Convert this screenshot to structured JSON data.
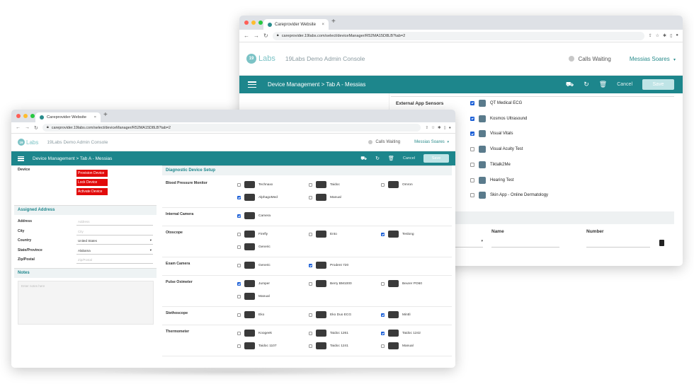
{
  "browser": {
    "tab_title": "Careprovider Website",
    "tab_close": "×",
    "new_tab": "+",
    "url_back": "←",
    "url_forward": "→",
    "url_reload": "↻",
    "back_url": "careprovider.19labs.com/select/deviceManager/R52MA15D8LB?tab=2",
    "front_url": "careprovider.19labs.com/select/deviceManager/R52MA15D8LB?tab=2"
  },
  "app": {
    "logo_badge": "19",
    "logo_text": "Labs",
    "console_title": "19Labs Demo Admin Console",
    "calls_waiting": "Calls Waiting",
    "user_name": "Messias Soares",
    "user_caret": "▾",
    "breadcrumb": "Device Management > Tab A - Messias",
    "cancel_label": "Cancel",
    "save_label": "Save"
  },
  "back_window": {
    "external_sensors_label": "External App Sensors",
    "external_sensors": [
      {
        "name": "QT Medical ECG",
        "checked": true
      },
      {
        "name": "Kosmos Ultrasound",
        "checked": true
      },
      {
        "name": "Visual Vitals",
        "checked": true
      },
      {
        "name": "Visual Acuity Test",
        "checked": false
      },
      {
        "name": "Tiktalk2Me",
        "checked": false
      },
      {
        "name": "Hearing Test",
        "checked": false
      },
      {
        "name": "Skin App - Online Dermatology",
        "checked": false
      }
    ],
    "name_col": "Name",
    "number_col": "Number"
  },
  "front_window": {
    "device_label": "Device",
    "device_buttons": [
      "Provision Device",
      "Lock Device",
      "Activate Device"
    ],
    "assigned_address_title": "Assigned Address",
    "address_fields": [
      {
        "label": "Address",
        "value": "Address"
      },
      {
        "label": "City",
        "value": "City"
      },
      {
        "label": "Country",
        "value": "United States"
      },
      {
        "label": "State/Province",
        "value": "Alabama"
      },
      {
        "label": "Zip/Postal",
        "value": "Zip/Postal"
      }
    ],
    "notes_title": "Notes",
    "notes_placeholder": "Enter notes here",
    "diag_title": "Diagnostic Device Setup",
    "categories": [
      {
        "label": "Blood Pressure Monitor",
        "devices": [
          {
            "name": "Technaxx",
            "checked": false
          },
          {
            "name": "Taidoc",
            "checked": false
          },
          {
            "name": "Omron",
            "checked": false
          },
          {
            "name": "AlphagoMed",
            "checked": true
          },
          {
            "name": "Manual",
            "checked": false
          }
        ]
      },
      {
        "label": "Internal Camera",
        "devices": [
          {
            "name": "Camera",
            "checked": true
          }
        ]
      },
      {
        "label": "Otoscope",
        "devices": [
          {
            "name": "Firefly",
            "checked": false
          },
          {
            "name": "Ento",
            "checked": false
          },
          {
            "name": "Teslong",
            "checked": true
          },
          {
            "name": "Generic",
            "checked": false
          }
        ]
      },
      {
        "label": "Exam Camera",
        "devices": [
          {
            "name": "Generic",
            "checked": false
          },
          {
            "name": "Prodent 720",
            "checked": true
          }
        ]
      },
      {
        "label": "Pulse Oximeter",
        "devices": [
          {
            "name": "Jumper",
            "checked": true
          },
          {
            "name": "Berry BM1000",
            "checked": false
          },
          {
            "name": "Beurer PO60",
            "checked": false
          },
          {
            "name": "Manual",
            "checked": false
          }
        ]
      },
      {
        "label": "Stethoscope",
        "devices": [
          {
            "name": "Eko",
            "checked": false
          },
          {
            "name": "Eko Duo ECG",
            "checked": false
          },
          {
            "name": "Minttì",
            "checked": true
          }
        ]
      },
      {
        "label": "Thermometer",
        "devices": [
          {
            "name": "Koogeek",
            "checked": false
          },
          {
            "name": "Taidoc 1261",
            "checked": false
          },
          {
            "name": "Taidoc 1242",
            "checked": true
          },
          {
            "name": "Taidoc 1107",
            "checked": false
          },
          {
            "name": "Taidoc 1241",
            "checked": false
          },
          {
            "name": "Manual",
            "checked": false
          }
        ]
      }
    ]
  },
  "colors": {
    "teal": "#1d868c",
    "red_button": "#e20b0b",
    "checkbox_blue": "#1a5ed6"
  }
}
